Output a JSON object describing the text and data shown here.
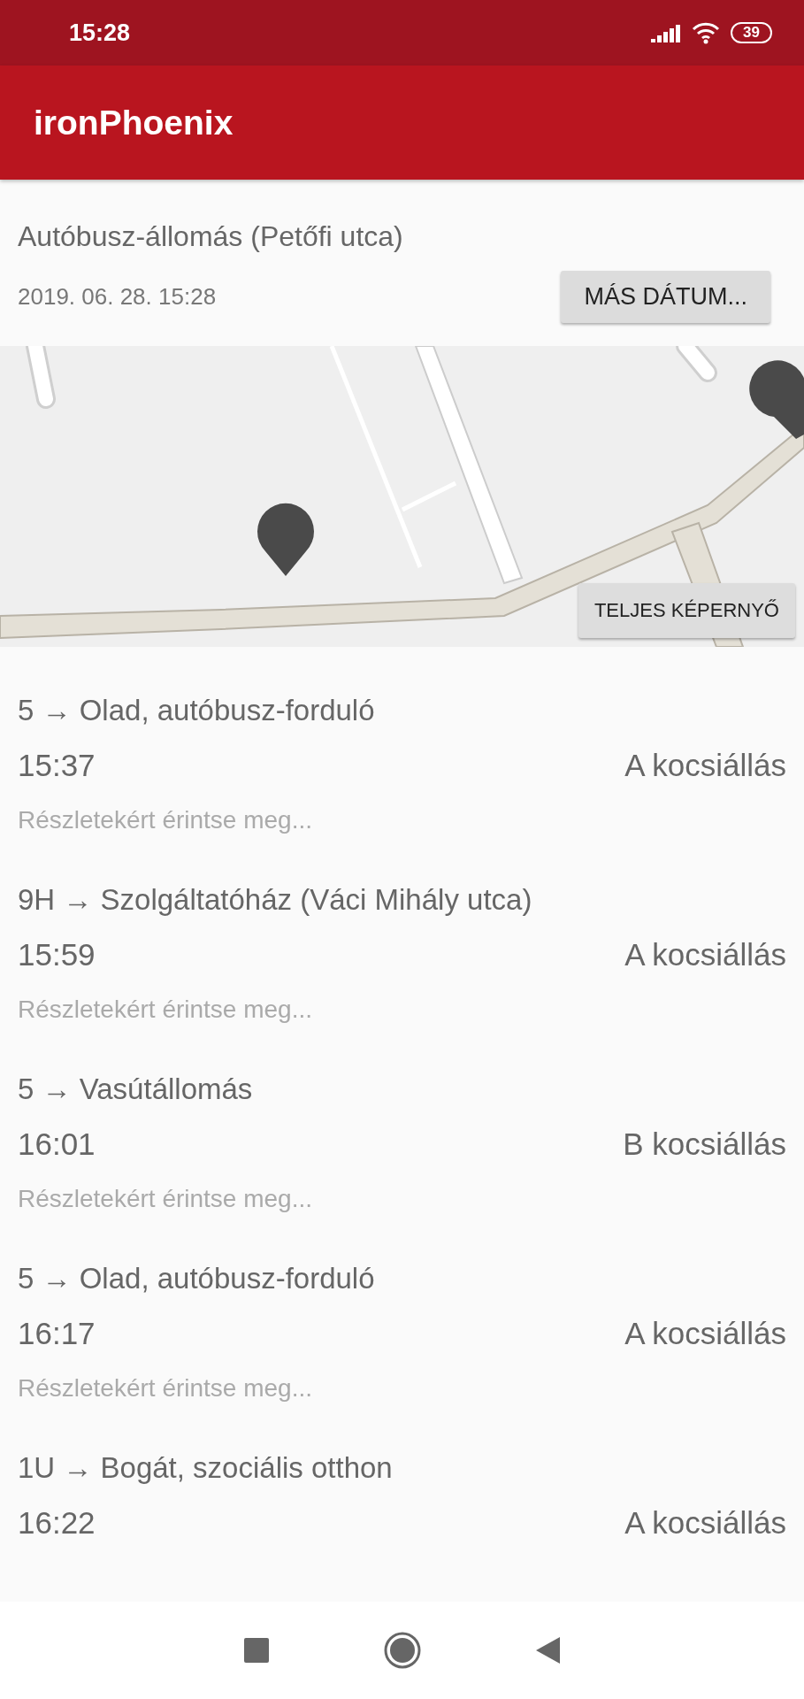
{
  "status_bar": {
    "time": "15:28",
    "battery": "39"
  },
  "app_bar": {
    "title": "ironPhoenix"
  },
  "stop": {
    "name": "Autóbusz-állomás (Petőfi utca)",
    "date": "2019. 06. 28. 15:28",
    "date_button": "MÁS DÁTUM..."
  },
  "map": {
    "kind": "picture",
    "fullscreen_button": "TELJES KÉPERNYŐ"
  },
  "departures": [
    {
      "route": "5 → Olad, autóbusz-forduló",
      "time": "15:37",
      "stand": "A kocsiállás",
      "hint": "Részletekért érintse meg..."
    },
    {
      "route": "9H → Szolgáltatóház (Váci Mihály utca)",
      "time": "15:59",
      "stand": "A kocsiállás",
      "hint": "Részletekért érintse meg..."
    },
    {
      "route": "5 → Vasútállomás",
      "time": "16:01",
      "stand": "B kocsiállás",
      "hint": "Részletekért érintse meg..."
    },
    {
      "route": "5 → Olad, autóbusz-forduló",
      "time": "16:17",
      "stand": "A kocsiállás",
      "hint": "Részletekért érintse meg..."
    },
    {
      "route": "1U → Bogát, szociális otthon",
      "time": "16:22",
      "stand": "A kocsiállás"
    }
  ]
}
